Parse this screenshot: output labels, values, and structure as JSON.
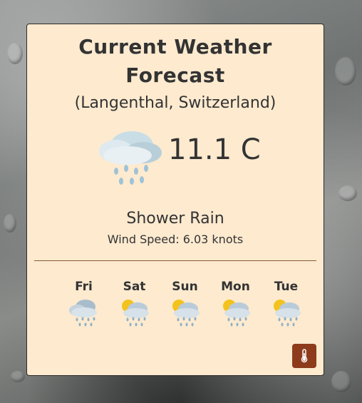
{
  "header": {
    "title": "Current Weather Forecast",
    "location": "(Langenthal, Switzerland)"
  },
  "current": {
    "temperature": "11.1 C",
    "icon": "cloud-rain-icon",
    "condition": "Shower Rain",
    "wind": "Wind Speed: 6.03 knots"
  },
  "forecast": [
    {
      "day": "Fri",
      "icon": "cloud-rain-icon"
    },
    {
      "day": "Sat",
      "icon": "sun-cloud-rain-icon"
    },
    {
      "day": "Sun",
      "icon": "sun-cloud-rain-icon"
    },
    {
      "day": "Mon",
      "icon": "sun-cloud-rain-icon"
    },
    {
      "day": "Tue",
      "icon": "sun-cloud-rain-icon"
    }
  ],
  "controls": {
    "unit_toggle_icon": "thermometer-icon"
  },
  "colors": {
    "card_bg": "#fdeacf",
    "text": "#333333",
    "button": "#8e3b1c"
  }
}
